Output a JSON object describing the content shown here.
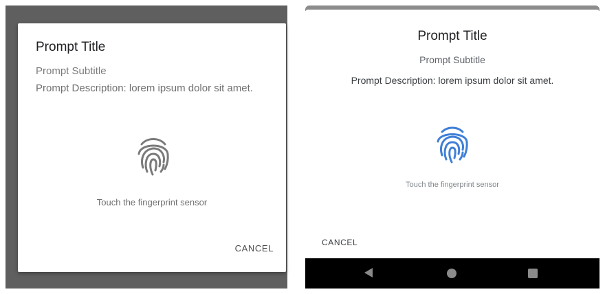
{
  "left": {
    "title": "Prompt Title",
    "subtitle": "Prompt Subtitle",
    "description": "Prompt Description: lorem ipsum dolor sit amet.",
    "hint": "Touch the fingerprint sensor",
    "cancel": "CANCEL",
    "fingerprint_icon": "fingerprint-icon",
    "fingerprint_color": "#7a7a7a"
  },
  "right": {
    "title": "Prompt Title",
    "subtitle": "Prompt Subtitle",
    "description": "Prompt Description: lorem ipsum dolor sit amet.",
    "hint": "Touch the fingerprint sensor",
    "cancel": "CANCEL",
    "fingerprint_icon": "fingerprint-icon",
    "fingerprint_color": "#3f7fd8",
    "nav": {
      "back_icon": "back-triangle-icon",
      "home_icon": "home-circle-icon",
      "recents_icon": "recents-square-icon"
    }
  }
}
